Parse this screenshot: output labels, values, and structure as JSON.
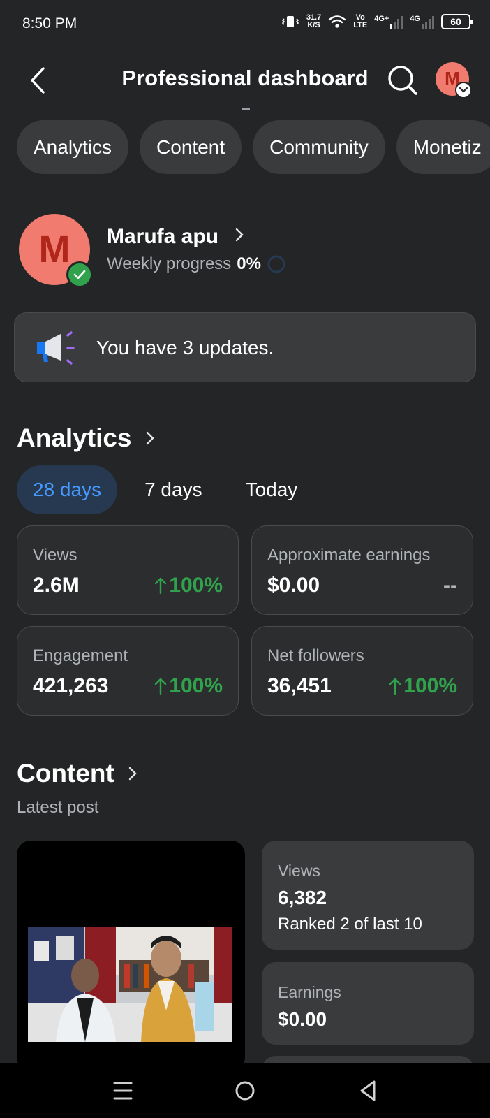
{
  "status_bar": {
    "time": "8:50 PM",
    "speed_value": "31.7",
    "speed_unit": "K/S",
    "volte_top": "Vo",
    "volte_bottom": "LTE",
    "net1": "4G+",
    "net2": "4G",
    "battery": "60"
  },
  "header": {
    "title": "Professional dashboard",
    "avatar_letter": "M"
  },
  "tabs": [
    "Analytics",
    "Content",
    "Community",
    "Monetiz"
  ],
  "profile": {
    "avatar_letter": "M",
    "name": "Marufa apu",
    "progress_label": "Weekly progress",
    "progress_value": "0%"
  },
  "updates": {
    "text": "You have 3 updates."
  },
  "analytics": {
    "title": "Analytics",
    "periods": [
      "28 days",
      "7 days",
      "Today"
    ],
    "cards": [
      {
        "label": "Views",
        "value": "2.6M",
        "change": "100%"
      },
      {
        "label": "Approximate earnings",
        "value": "$0.00",
        "change": "--"
      },
      {
        "label": "Engagement",
        "value": "421,263",
        "change": "100%"
      },
      {
        "label": "Net followers",
        "value": "36,451",
        "change": "100%"
      }
    ]
  },
  "content": {
    "title": "Content",
    "subtitle": "Latest post",
    "views": {
      "label": "Views",
      "value": "6,382",
      "rank": "Ranked 2 of last 10"
    },
    "earnings": {
      "label": "Earnings",
      "value": "$0.00"
    }
  },
  "colors": {
    "background": "#242526",
    "accent_blue": "#4599ff",
    "positive_green": "#31a24c",
    "avatar": "#f07b6e"
  }
}
